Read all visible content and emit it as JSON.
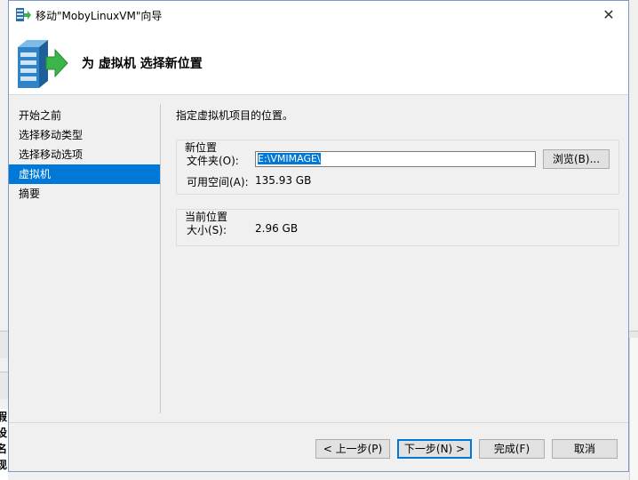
{
  "window": {
    "title": "移动\"MobyLinuxVM\"向导",
    "close_glyph": "✕"
  },
  "header": {
    "title": "为 虚拟机 选择新位置"
  },
  "nav": {
    "items": [
      {
        "label": "开始之前",
        "selected": false
      },
      {
        "label": "选择移动类型",
        "selected": false
      },
      {
        "label": "选择移动选项",
        "selected": false
      },
      {
        "label": "虚拟机",
        "selected": true
      },
      {
        "label": "摘要",
        "selected": false
      }
    ]
  },
  "content": {
    "instruction": "指定虚拟机项目的位置。",
    "new_location": {
      "group_title": "新位置",
      "folder_label": "文件夹(O):",
      "folder_value": "E:\\VMIMAGE\\",
      "browse_label": "浏览(B)...",
      "available_label": "可用空间(A):",
      "available_value": "135.93 GB"
    },
    "current_location": {
      "group_title": "当前位置",
      "size_label": "大小(S):",
      "size_value": "2.96 GB"
    }
  },
  "footer": {
    "prev_label": "< 上一步(P)",
    "next_label": "下一步(N) >",
    "finish_label": "完成(F)",
    "cancel_label": "取消"
  },
  "background": {
    "left_glyphs": [
      "假",
      "设",
      "名",
      "现"
    ]
  },
  "colors": {
    "accent": "#0078d7",
    "header_bg": "#ffffff",
    "dialog_bg": "#f0f0f0"
  }
}
